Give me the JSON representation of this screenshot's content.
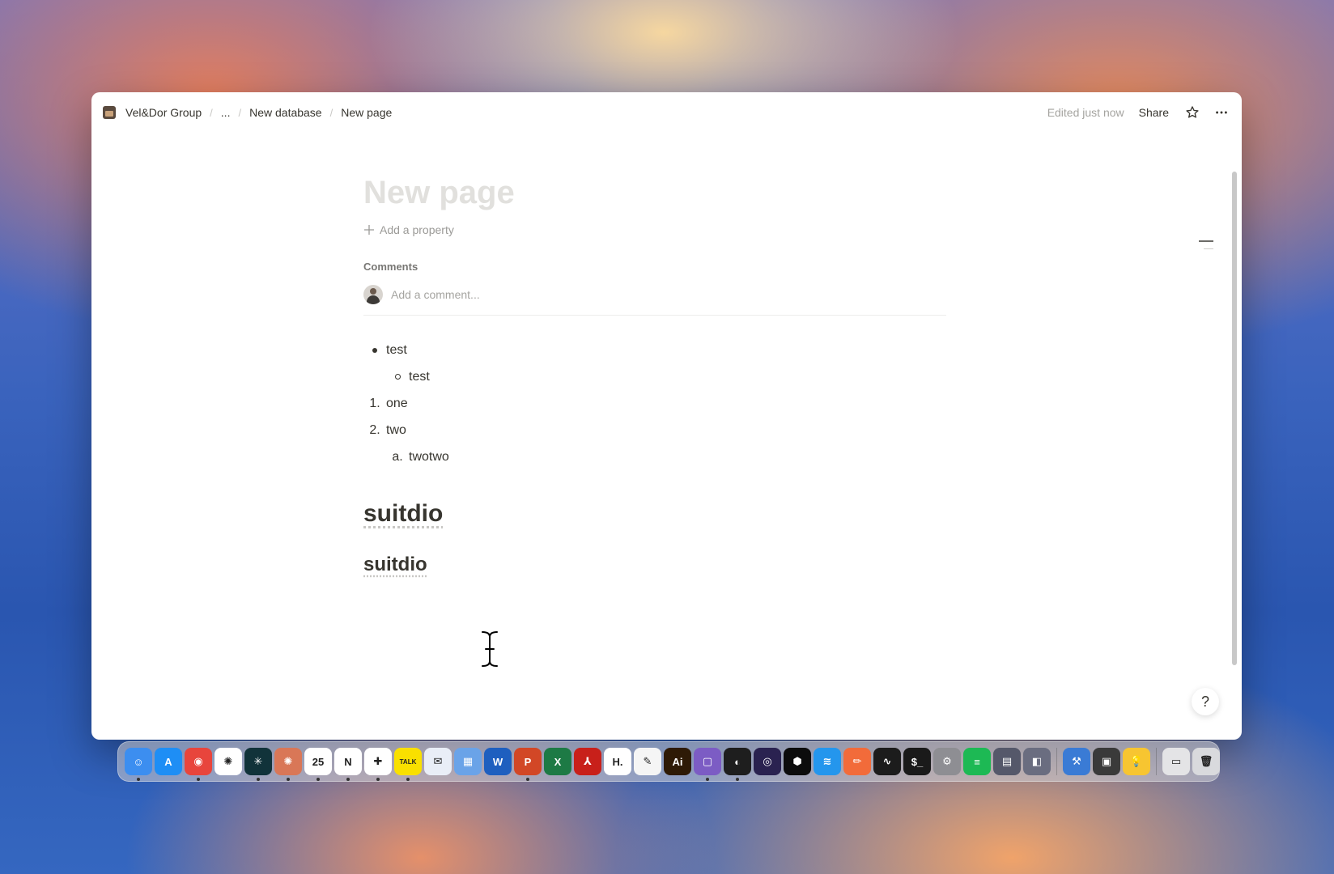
{
  "breadcrumb": {
    "workspace": "Vel&Dor Group",
    "ellipsis": "...",
    "database": "New database",
    "page": "New page"
  },
  "topbar": {
    "edited": "Edited just now",
    "share": "Share"
  },
  "page": {
    "title": "New page",
    "add_property": "Add a property",
    "comments_label": "Comments",
    "comment_placeholder": "Add a comment..."
  },
  "blocks": {
    "bullet1": "test",
    "bullet1_child": "test",
    "num1_marker": "1.",
    "num1": "one",
    "num2_marker": "2.",
    "num2": "two",
    "num2a_marker": "a.",
    "num2a": "twotwo",
    "heading1": "suitdio",
    "heading2": "suitdio"
  },
  "dock": {
    "apps": [
      {
        "name": "finder-icon",
        "color": "#3c8ef0",
        "glyph": "☺",
        "running": true
      },
      {
        "name": "app-store-icon",
        "color": "#1e8ef5",
        "glyph": "A",
        "running": false
      },
      {
        "name": "chrome-icon",
        "color": "#e8453c",
        "glyph": "◉",
        "running": true
      },
      {
        "name": "chatgpt-icon",
        "color": "#ffffff",
        "glyph": "✺",
        "running": false
      },
      {
        "name": "perplexity-icon",
        "color": "#11333a",
        "glyph": "✳",
        "running": true
      },
      {
        "name": "claude-icon",
        "color": "#d97757",
        "glyph": "✺",
        "running": true
      },
      {
        "name": "calendar-icon",
        "color": "#ffffff",
        "glyph": "25",
        "running": true
      },
      {
        "name": "notion-icon",
        "color": "#ffffff",
        "glyph": "N",
        "running": true
      },
      {
        "name": "slack-icon",
        "color": "#ffffff",
        "glyph": "✚",
        "running": true
      },
      {
        "name": "kakaotalk-icon",
        "color": "#f9e000",
        "glyph": "TALK",
        "running": true
      },
      {
        "name": "mail-icon",
        "color": "#e9eef7",
        "glyph": "✉",
        "running": false
      },
      {
        "name": "teams-icon",
        "color": "#6aa3e8",
        "glyph": "▦",
        "running": false
      },
      {
        "name": "word-icon",
        "color": "#1e5fbf",
        "glyph": "W",
        "running": false
      },
      {
        "name": "powerpoint-icon",
        "color": "#d24726",
        "glyph": "P",
        "running": true
      },
      {
        "name": "excel-icon",
        "color": "#1d7a45",
        "glyph": "X",
        "running": false
      },
      {
        "name": "acrobat-icon",
        "color": "#c8201a",
        "glyph": "⅄",
        "running": false
      },
      {
        "name": "hangul-icon",
        "color": "#ffffff",
        "glyph": "H.",
        "running": false
      },
      {
        "name": "textedit-icon",
        "color": "#f5f5f5",
        "glyph": "✎",
        "running": false
      },
      {
        "name": "illustrator-icon",
        "color": "#2e1a06",
        "glyph": "Ai",
        "running": false
      },
      {
        "name": "screenshot-icon",
        "color": "#7c5cc4",
        "glyph": "▢",
        "running": true
      },
      {
        "name": "figma-icon",
        "color": "#1e1e1e",
        "glyph": "◐",
        "running": true
      },
      {
        "name": "obs-icon",
        "color": "#2a2250",
        "glyph": "◎",
        "running": false
      },
      {
        "name": "cursor-app-icon",
        "color": "#0c0c0c",
        "glyph": "⬢",
        "running": false
      },
      {
        "name": "docker-icon",
        "color": "#2496ed",
        "glyph": "≋",
        "running": false
      },
      {
        "name": "pencil-icon",
        "color": "#f26b3a",
        "glyph": "✏",
        "running": false
      },
      {
        "name": "activity-monitor-icon",
        "color": "#1c1c1c",
        "glyph": "∿",
        "running": false
      },
      {
        "name": "terminal-icon",
        "color": "#1a1a1a",
        "glyph": "$_",
        "running": false
      },
      {
        "name": "system-settings-icon",
        "color": "#8e8e93",
        "glyph": "⚙",
        "running": false
      },
      {
        "name": "spotify-icon",
        "color": "#1db954",
        "glyph": "≡",
        "running": false
      },
      {
        "name": "app-grid-icon",
        "color": "#55586a",
        "glyph": "▤",
        "running": false
      },
      {
        "name": "utility-icon",
        "color": "#6a6d80",
        "glyph": "◧",
        "running": false
      }
    ],
    "apps2": [
      {
        "name": "xcode-icon",
        "color": "#3a7bd5",
        "glyph": "⚒",
        "running": false
      },
      {
        "name": "qr-icon",
        "color": "#3a3a3a",
        "glyph": "▣",
        "running": false
      },
      {
        "name": "tips-icon",
        "color": "#f7c531",
        "glyph": "💡",
        "running": false
      }
    ],
    "apps3": [
      {
        "name": "downloads-folder-icon",
        "color": "#e4e4e6",
        "glyph": "▭",
        "running": false
      },
      {
        "name": "trash-icon",
        "color": "#d9dadd",
        "glyph": "🗑",
        "running": false
      }
    ]
  }
}
